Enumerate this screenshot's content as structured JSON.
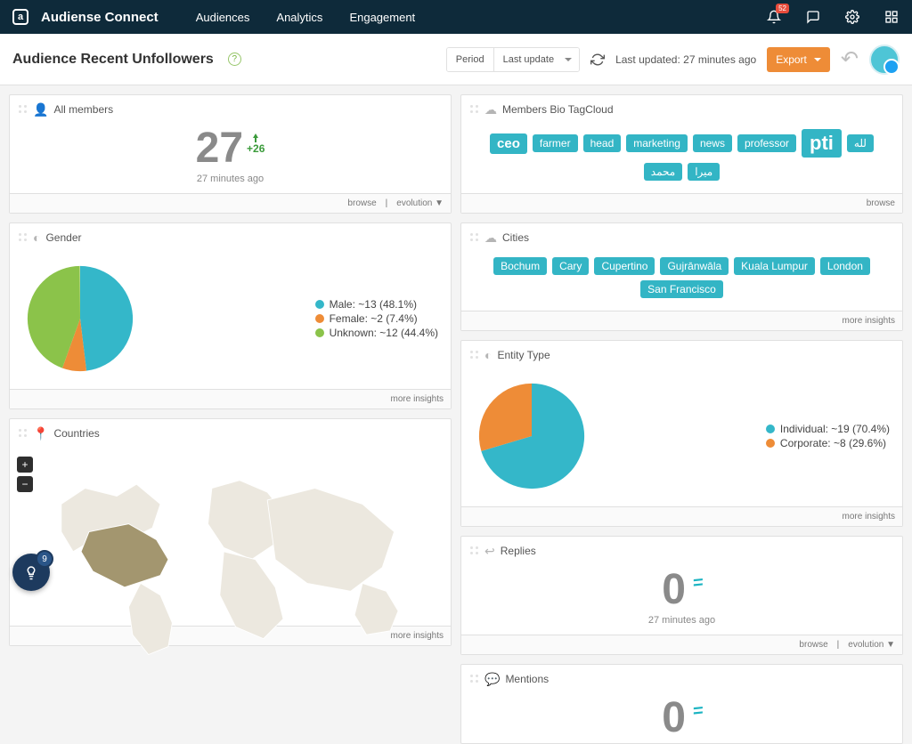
{
  "brand": "Audiense Connect",
  "nav": {
    "audiences": "Audiences",
    "analytics": "Analytics",
    "engagement": "Engagement",
    "notifications_badge": "52"
  },
  "toolbar": {
    "title": "Audience Recent Unfollowers",
    "period_label": "Period",
    "period_value": "Last update",
    "last_updated": "Last updated: 27 minutes ago",
    "export": "Export"
  },
  "panels": {
    "all_members": {
      "title": "All members",
      "value": "27",
      "delta": "+26",
      "timestamp": "27 minutes ago",
      "browse": "browse",
      "evolution": "evolution ▼"
    },
    "gender": {
      "title": "Gender",
      "more": "more insights"
    },
    "countries": {
      "title": "Countries",
      "more": "more insights"
    },
    "tagcloud": {
      "title": "Members Bio TagCloud",
      "browse": "browse"
    },
    "cities": {
      "title": "Cities",
      "more": "more insights"
    },
    "entity": {
      "title": "Entity Type",
      "more": "more insights"
    },
    "replies": {
      "title": "Replies",
      "value": "0",
      "timestamp": "27 minutes ago",
      "browse": "browse",
      "evolution": "evolution ▼"
    },
    "mentions": {
      "title": "Mentions",
      "value": "0"
    }
  },
  "tags": [
    "ceo",
    "farmer",
    "head",
    "marketing",
    "news",
    "professor",
    "pti",
    "لله",
    "محمد",
    "میرا"
  ],
  "cities": [
    "Bochum",
    "Cary",
    "Cupertino",
    "Gujrānwāla",
    "Kuala Lumpur",
    "London",
    "San Francisco"
  ],
  "bulb_count": "9",
  "chart_data": [
    {
      "id": "gender",
      "type": "pie",
      "title": "Gender",
      "series": [
        {
          "name": "Male",
          "value": 13,
          "percent": 48.1,
          "label": "Male: ~13 (48.1%)",
          "color": "#34b7c9"
        },
        {
          "name": "Female",
          "value": 2,
          "percent": 7.4,
          "label": "Female: ~2 (7.4%)",
          "color": "#ee8c37"
        },
        {
          "name": "Unknown",
          "value": 12,
          "percent": 44.4,
          "label": "Unknown: ~12 (44.4%)",
          "color": "#8bc34a"
        }
      ]
    },
    {
      "id": "entity",
      "type": "pie",
      "title": "Entity Type",
      "series": [
        {
          "name": "Individual",
          "value": 19,
          "percent": 70.4,
          "label": "Individual: ~19 (70.4%)",
          "color": "#34b7c9"
        },
        {
          "name": "Corporate",
          "value": 8,
          "percent": 29.6,
          "label": "Corporate: ~8 (29.6%)",
          "color": "#ee8c37"
        }
      ]
    }
  ]
}
